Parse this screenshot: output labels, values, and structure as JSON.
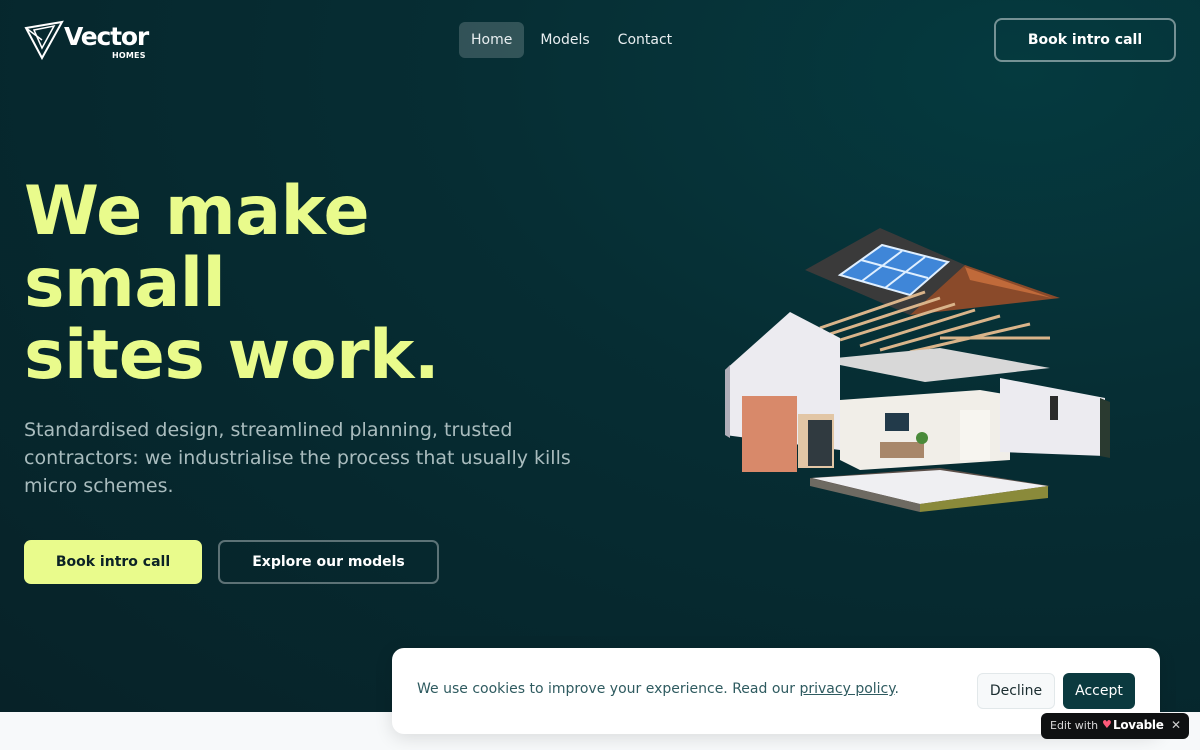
{
  "brand": {
    "name": "Vector",
    "sub": "HOMES"
  },
  "nav": {
    "items": [
      {
        "label": "Home",
        "active": true
      },
      {
        "label": "Models",
        "active": false
      },
      {
        "label": "Contact",
        "active": false
      }
    ]
  },
  "header": {
    "cta_label": "Book intro call"
  },
  "hero": {
    "headline_lines": [
      "We make",
      "small",
      "sites work."
    ],
    "subtext": "Standardised design, streamlined planning, trusted contractors: we industrialise the process that usually kills micro schemes.",
    "primary_label": "Book intro call",
    "secondary_label": "Explore our models",
    "image_icon": "exploded-house-illustration"
  },
  "cookie": {
    "text": "We use cookies to improve your experience. Read our ",
    "link_text": "privacy policy",
    "suffix": ".",
    "decline_label": "Decline",
    "accept_label": "Accept"
  },
  "badge": {
    "edit_text": "Edit with",
    "brand_text": "Lovable",
    "close_icon": "close-icon"
  },
  "colors": {
    "accent": "#e9fb8c",
    "hero_bg": "#062d33",
    "accept_bg": "#0b3a3f"
  }
}
